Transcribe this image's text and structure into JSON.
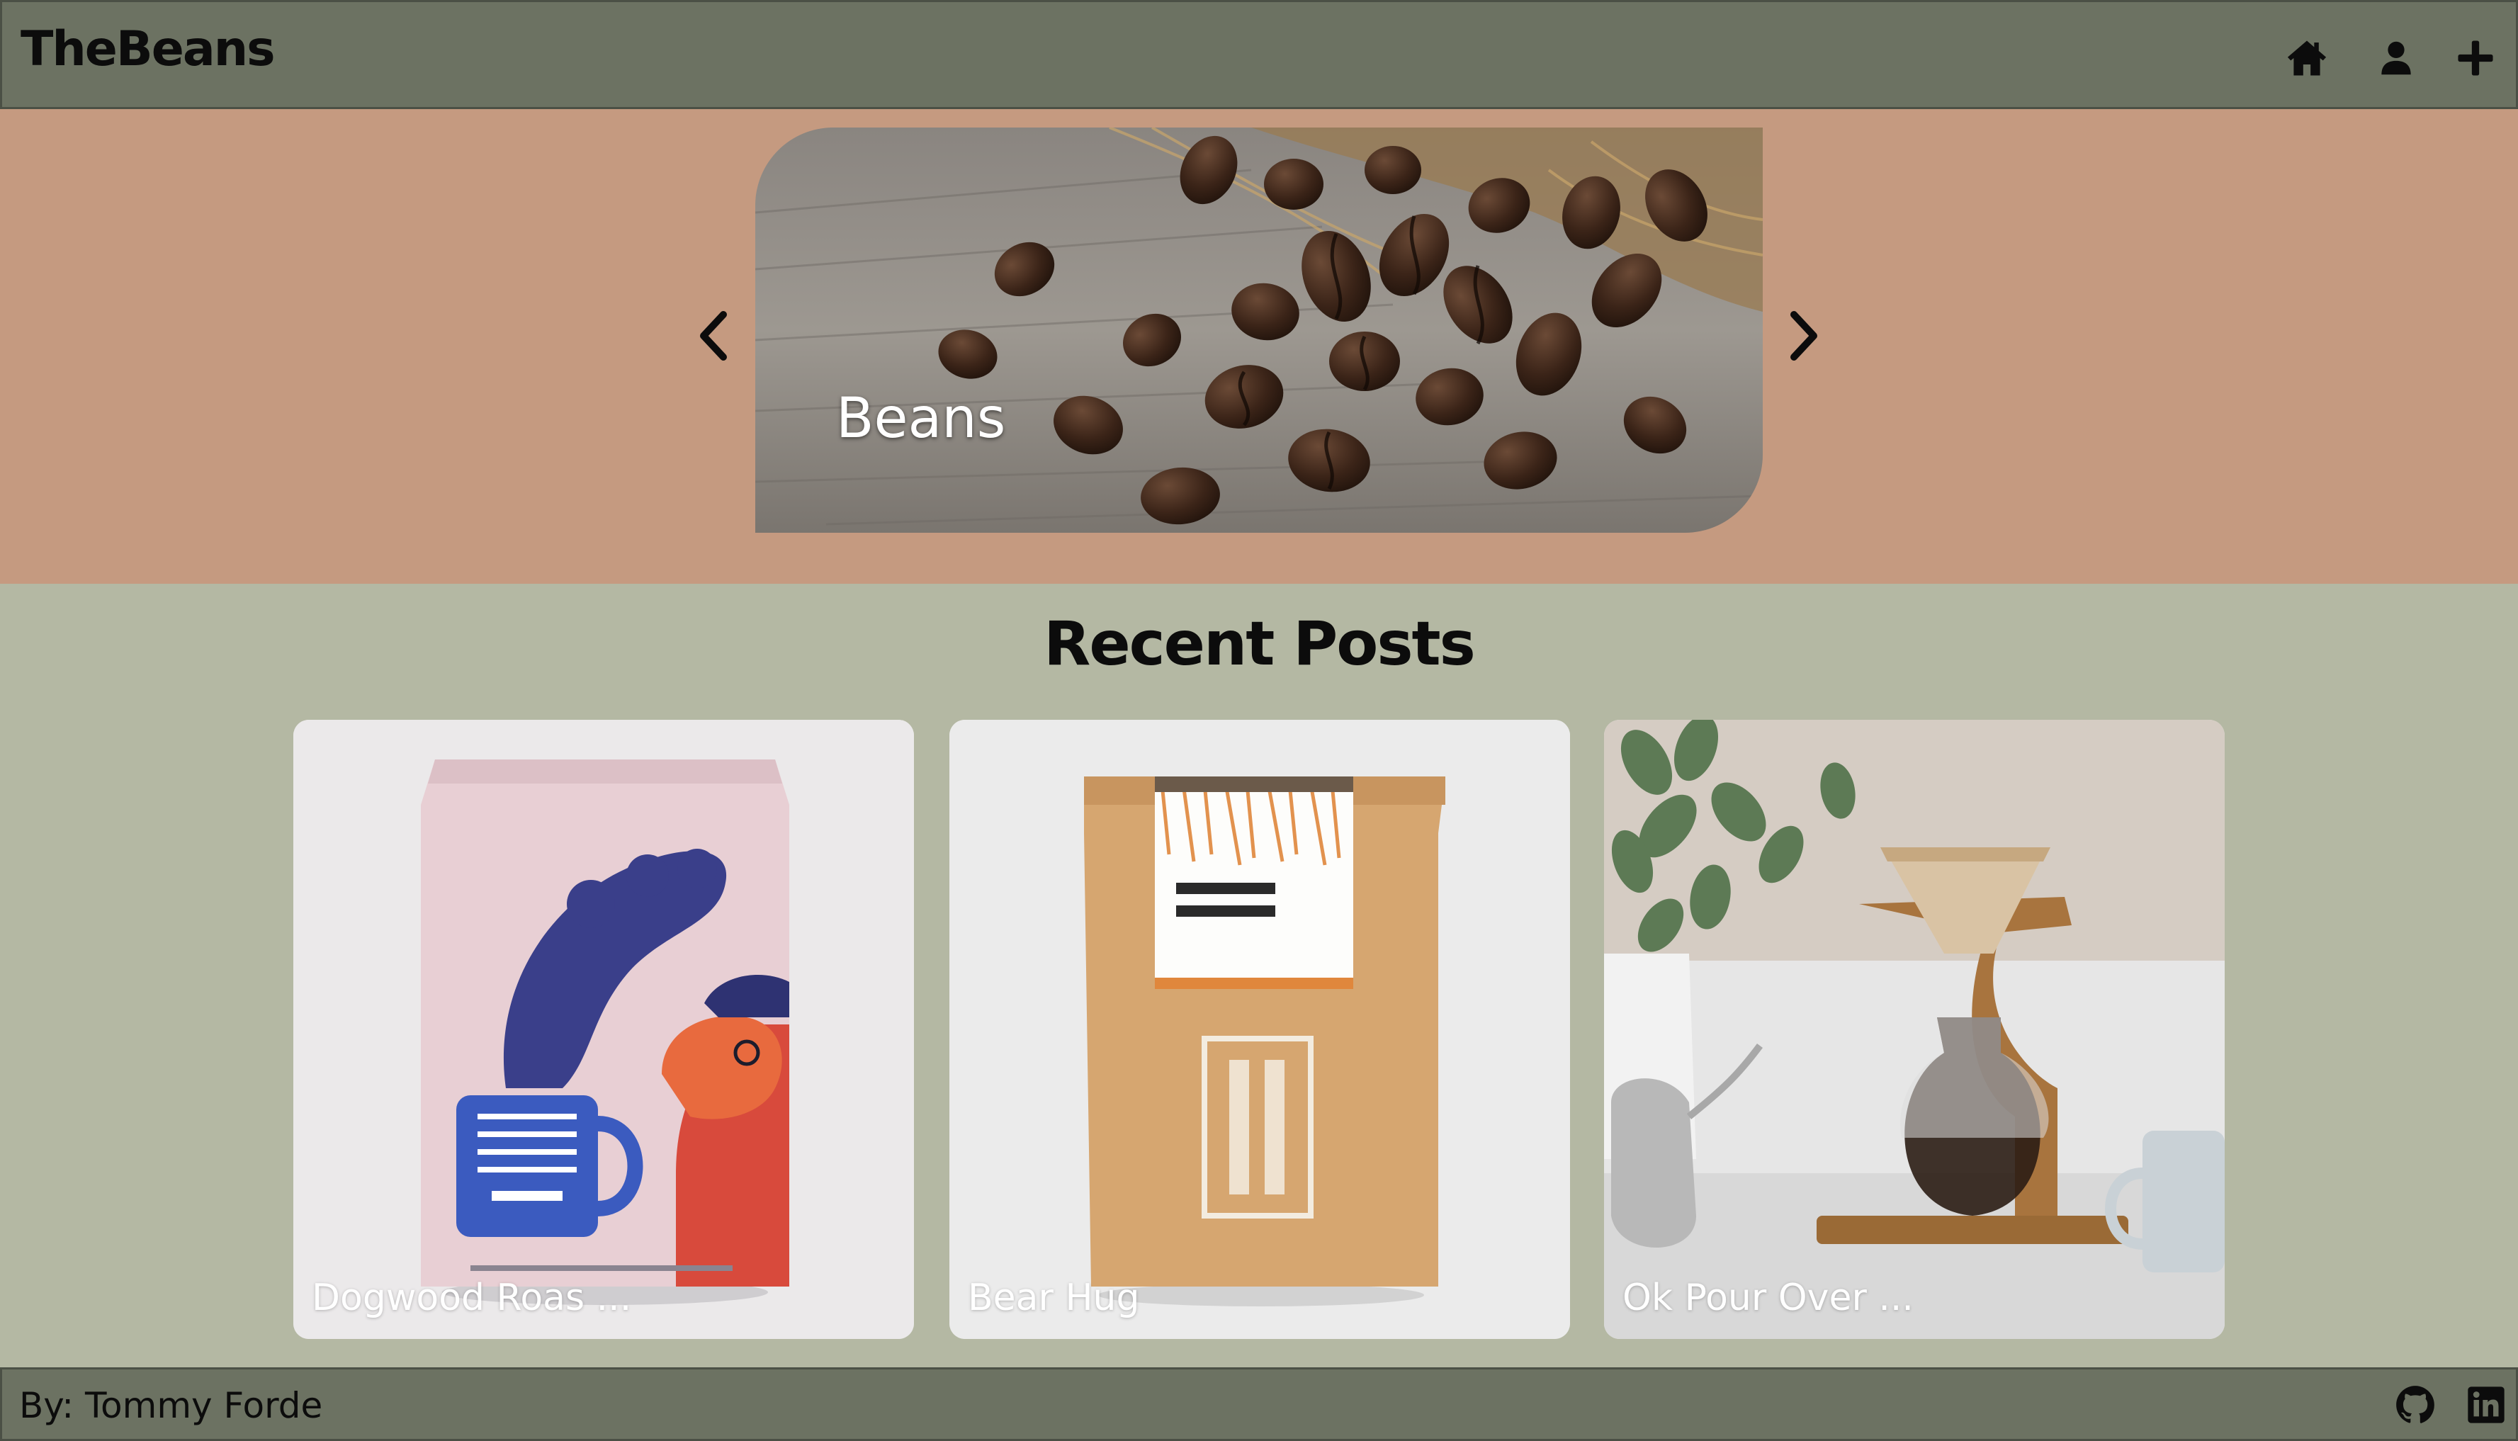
{
  "navbar": {
    "brand": "TheBeans",
    "icons": [
      "home-icon",
      "user-icon",
      "plus-icon"
    ]
  },
  "carousel": {
    "caption": "Beans",
    "prev_icon": "chevron-left-icon",
    "next_icon": "chevron-right-icon"
  },
  "recent_posts": {
    "title": "Recent Posts",
    "posts": [
      {
        "caption": "Dogwood Roas ..."
      },
      {
        "caption": "Bear Hug"
      },
      {
        "caption": "Ok Pour Over ..."
      }
    ]
  },
  "footer": {
    "credit": "By: Tommy Forde",
    "icons": [
      "github-icon",
      "linkedin-icon"
    ]
  },
  "colors": {
    "navbar": "#6c7262",
    "carousel_band": "#c59a80",
    "page": "#b4b8a3",
    "card": "#e9e9ea"
  }
}
